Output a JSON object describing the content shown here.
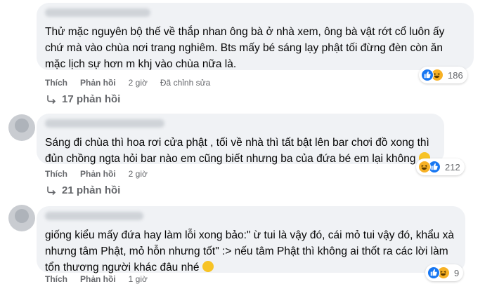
{
  "comments": [
    {
      "text": "Thử mặc nguyên bộ thế về thắp nhan ông bà ở nhà xem, ông bà vật rớt cổ luôn ấy chứ mà vào chùa nơi trang nghiêm. Bts mấy bé sáng lạy phật tối đừng đèn còn ăn mặc lịch sự hơn m khj vào chùa nữa là.",
      "actions": {
        "like": "Thích",
        "reply": "Phản hồi",
        "time": "2 giờ",
        "edited": "Đã chỉnh sửa"
      },
      "reaction_count": "186",
      "replies_label": "17 phản hồi"
    },
    {
      "text": "Sáng đi chùa thì hoa rơi cửa phật , tối về nhà thì tất bật lên bar chơi đồ xong thì đủn chồng ngta hỏi bar nào em cũng biết nhưng ba của đứa bé em lại không",
      "actions": {
        "like": "Thích",
        "reply": "Phản hồi",
        "time": "2 giờ"
      },
      "reaction_count": "212",
      "replies_label": "21 phản hồi"
    },
    {
      "text": "giống kiểu mấy đứa hay làm lỗi xong bảo:\" ừ tui là vậy đó, cái mỏ tui vậy đó, khẩu xà nhưng tâm Phật, mỏ hỗn nhưng tốt\" :> nếu tâm Phật thì không ai thốt ra các lời làm tổn thương người khác đâu nhé",
      "actions": {
        "like": "Thích",
        "reply": "Phản hồi",
        "time": "1 giờ"
      },
      "reaction_count": "9"
    }
  ],
  "colors": {
    "bubble": "#f0f2f5",
    "meta_text": "#65676b",
    "like_blue": "#1877f2",
    "haha_yellow": "#f7b125"
  },
  "icons": [
    "like-icon",
    "haha-icon",
    "reply-arrow-icon",
    "avatar"
  ]
}
